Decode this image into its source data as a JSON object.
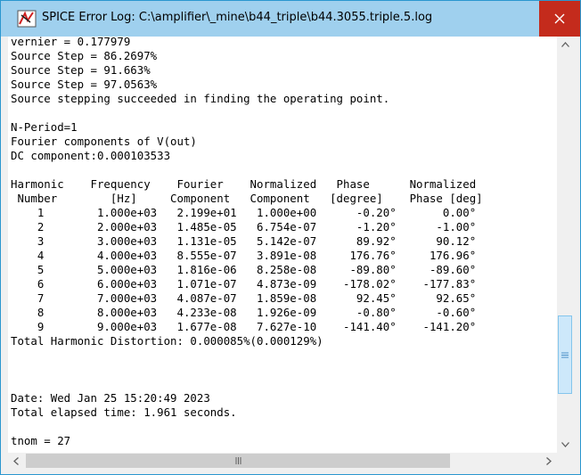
{
  "window": {
    "title": "SPICE Error Log: C:\\amplifier\\_mine\\b44_triple\\b44.3055.triple.5.log"
  },
  "icons": {
    "app": "spice-error-log-icon",
    "close": "close-icon",
    "scroll_up": "chevron-up-icon",
    "scroll_down": "chevron-down-icon",
    "scroll_left": "chevron-left-icon",
    "scroll_right": "chevron-right-icon"
  },
  "colors": {
    "titlebar": "#9fd0ee",
    "close": "#c42b1c",
    "thumb": "#cde8fa"
  },
  "log": {
    "lines": [
      "vernier = 0.177979",
      "Source Step = 86.2697%",
      "Source Step = 91.663%",
      "Source Step = 97.0563%",
      "Source stepping succeeded in finding the operating point.",
      "",
      "N-Period=1",
      "Fourier components of V(out)",
      "DC component:0.000103533",
      "",
      "Harmonic    Frequency    Fourier    Normalized   Phase      Normalized",
      " Number        [Hz]     Component   Component   [degree]    Phase [deg]",
      "    1        1.000e+03   2.199e+01   1.000e+00      -0.20°       0.00°",
      "    2        2.000e+03   1.485e-05   6.754e-07      -1.20°      -1.00°",
      "    3        3.000e+03   1.131e-05   5.142e-07      89.92°      90.12°",
      "    4        4.000e+03   8.555e-07   3.891e-08     176.76°     176.96°",
      "    5        5.000e+03   1.816e-06   8.258e-08     -89.80°     -89.60°",
      "    6        6.000e+03   1.071e-07   4.873e-09    -178.02°    -177.83°",
      "    7        7.000e+03   4.087e-07   1.859e-08      92.45°      92.65°",
      "    8        8.000e+03   4.233e-08   1.926e-09      -0.80°      -0.60°",
      "    9        9.000e+03   1.677e-08   7.627e-10    -141.40°    -141.20°",
      "Total Harmonic Distortion: 0.000085%(0.000129%)",
      "",
      "",
      "",
      "Date: Wed Jan 25 15:20:49 2023",
      "Total elapsed time: 1.961 seconds.",
      "",
      "tnom = 27"
    ]
  }
}
